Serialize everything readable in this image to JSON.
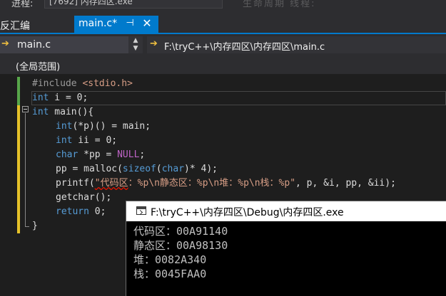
{
  "top_bar": {
    "process_label": "进程:",
    "process_value": "[7692] 内存四区.exe",
    "faded_toolbar": "生命周期   线程:"
  },
  "tabs": {
    "disassembly_label": "反汇编",
    "active_label": "main.c*",
    "pin_glyph": "⊣",
    "close_glyph": "✕"
  },
  "nav": {
    "file_label": "main.c",
    "path_label": "F:\\tryC++\\内存四区\\内存四区\\main.c",
    "arrow_glyph": "➔"
  },
  "scope": {
    "label": "(全局范围)"
  },
  "code": {
    "l1_pp": "#include ",
    "l1_hdr": "<stdio.h>",
    "l2_kw": "int",
    "l2_rest": " i = 0;",
    "l3_kw": "int",
    "l3_rest": " main(){",
    "l4_kw": "int",
    "l4_rest": "(*p)() = main;",
    "l5_kw": "int",
    "l5_rest": " ii = 0;",
    "l6_kw": "char",
    "l6_mid": " *pp = ",
    "l6_macro": "NULL",
    "l6_end": ";",
    "l7_pre": "pp = malloc(",
    "l7_kw": "sizeof",
    "l7_paren": "(",
    "l7_kw2": "char",
    "l7_end": ")* 4);",
    "l8_fn": "printf(",
    "l8_str_a": "\"代码区",
    "l8_str_b": "：%p\\n静态区：%p\\n堆：%p\\n栈：%p\"",
    "l8_end": ", p, &i, pp, &ii);",
    "l9": "getchar();",
    "l10_kw": "return",
    "l10_rest": " 0;",
    "l11": "}"
  },
  "console": {
    "title": "F:\\tryC++\\内存四区\\Debug\\内存四区.exe",
    "lines": [
      "代码区：00A91140",
      "静态区：00A98130",
      "堆：0082A340",
      "栈：0045FAA0"
    ]
  },
  "colors": {
    "accent": "#007acc",
    "keyword": "#569cd6",
    "string": "#d69d85",
    "macro": "#bd63c5",
    "change_saved": "#57a64a",
    "change_unsaved": "#e6c229"
  }
}
